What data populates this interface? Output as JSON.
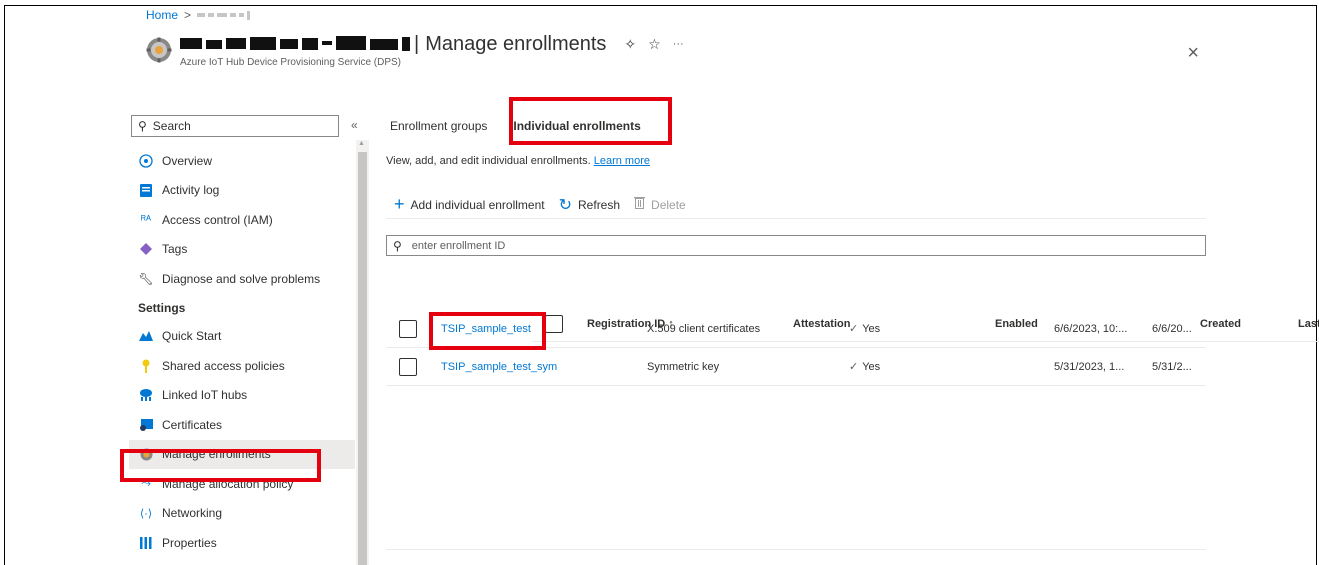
{
  "breadcrumb": {
    "home": "Home",
    "separator": ">"
  },
  "header": {
    "title": "Manage enrollments",
    "separator": "|",
    "subtitle": "Azure IoT Hub Device Provisioning Service (DPS)",
    "pin_icon": "pin-icon",
    "favorite_icon": "star-icon",
    "more_label": "···",
    "close_label": "×"
  },
  "sidebar": {
    "search_placeholder": "Search",
    "collapse_label": "«",
    "items_top": [
      {
        "label": "Overview",
        "icon": "overview-icon"
      },
      {
        "label": "Activity log",
        "icon": "activity-log-icon"
      },
      {
        "label": "Access control (IAM)",
        "icon": "iam-icon"
      },
      {
        "label": "Tags",
        "icon": "tag-icon"
      },
      {
        "label": "Diagnose and solve problems",
        "icon": "wrench-icon"
      }
    ],
    "settings_header": "Settings",
    "items_settings": [
      {
        "label": "Quick Start",
        "icon": "quickstart-icon"
      },
      {
        "label": "Shared access policies",
        "icon": "key-icon"
      },
      {
        "label": "Linked IoT hubs",
        "icon": "iot-hub-icon"
      },
      {
        "label": "Certificates",
        "icon": "certificate-icon"
      },
      {
        "label": "Manage enrollments",
        "icon": "gear-icon"
      },
      {
        "label": "Manage allocation policy",
        "icon": "allocation-icon"
      },
      {
        "label": "Networking",
        "icon": "networking-icon"
      },
      {
        "label": "Properties",
        "icon": "properties-icon"
      }
    ]
  },
  "tabs": [
    {
      "label": "Enrollment groups",
      "active": false
    },
    {
      "label": "Individual enrollments",
      "active": true
    }
  ],
  "description": {
    "text": "View, add, and edit individual enrollments.",
    "link": "Learn more"
  },
  "toolbar": {
    "add_label": "Add individual enrollment",
    "refresh_label": "Refresh",
    "delete_label": "Delete"
  },
  "filter": {
    "placeholder": "enter enrollment ID"
  },
  "table": {
    "columns": [
      "Registration ID ↑",
      "Attestation",
      "Enabled",
      "Created",
      "Last u..."
    ],
    "rows": [
      {
        "registration_id": "TSIP_sample_test",
        "attestation": "X.509 client certificates",
        "enabled": "Yes",
        "created": "6/6/2023, 10:...",
        "last_updated": "6/6/20..."
      },
      {
        "registration_id": "TSIP_sample_test_sym",
        "attestation": "Symmetric key",
        "enabled": "Yes",
        "created": "5/31/2023, 1...",
        "last_updated": "5/31/2..."
      }
    ]
  },
  "colors": {
    "accent": "#0078d4",
    "highlight": "#e5000f"
  }
}
